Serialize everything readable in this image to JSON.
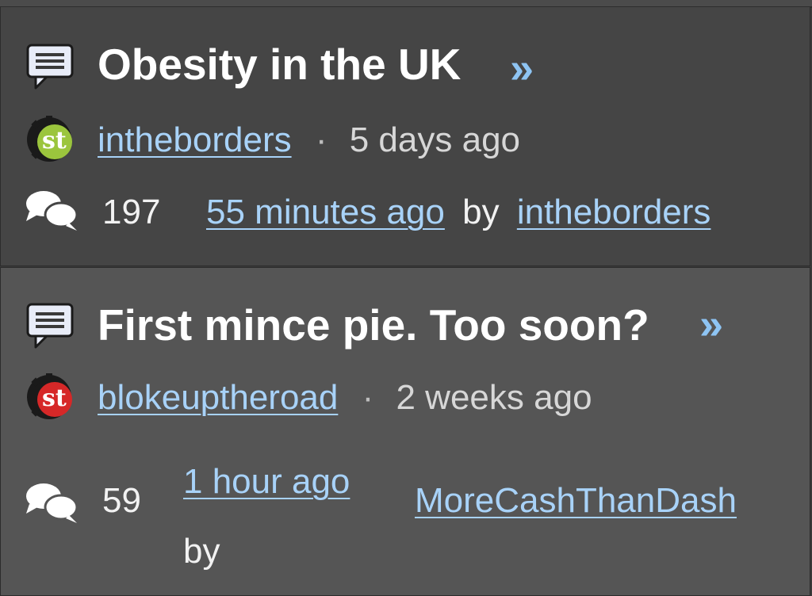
{
  "threads": [
    {
      "title": "Obesity in the UK",
      "jump_glyph": "»",
      "author": "intheborders",
      "separator": "·",
      "started": "5 days ago",
      "reply_count": "197",
      "last_post_time": "55 minutes ago",
      "by_text": "by",
      "last_poster": "intheborders",
      "avatar_color": "#9bc53d"
    },
    {
      "title": "First mince pie. Too soon?",
      "jump_glyph": "»",
      "author": "blokeuptheroad",
      "separator": "·",
      "started": "2 weeks ago",
      "reply_count": "59",
      "last_post_time": "1 hour ago",
      "by_text": "by",
      "last_poster": "MoreCashThanDash",
      "avatar_color": "#d62828"
    }
  ],
  "colors": {
    "link": "#a8d2f8",
    "jump": "#8ec4f3",
    "title": "#ffffff"
  },
  "icons": {
    "thread": "discussion-thread-icon",
    "replies": "replies-bubbles-icon",
    "avatar": "user-avatar-icon"
  }
}
